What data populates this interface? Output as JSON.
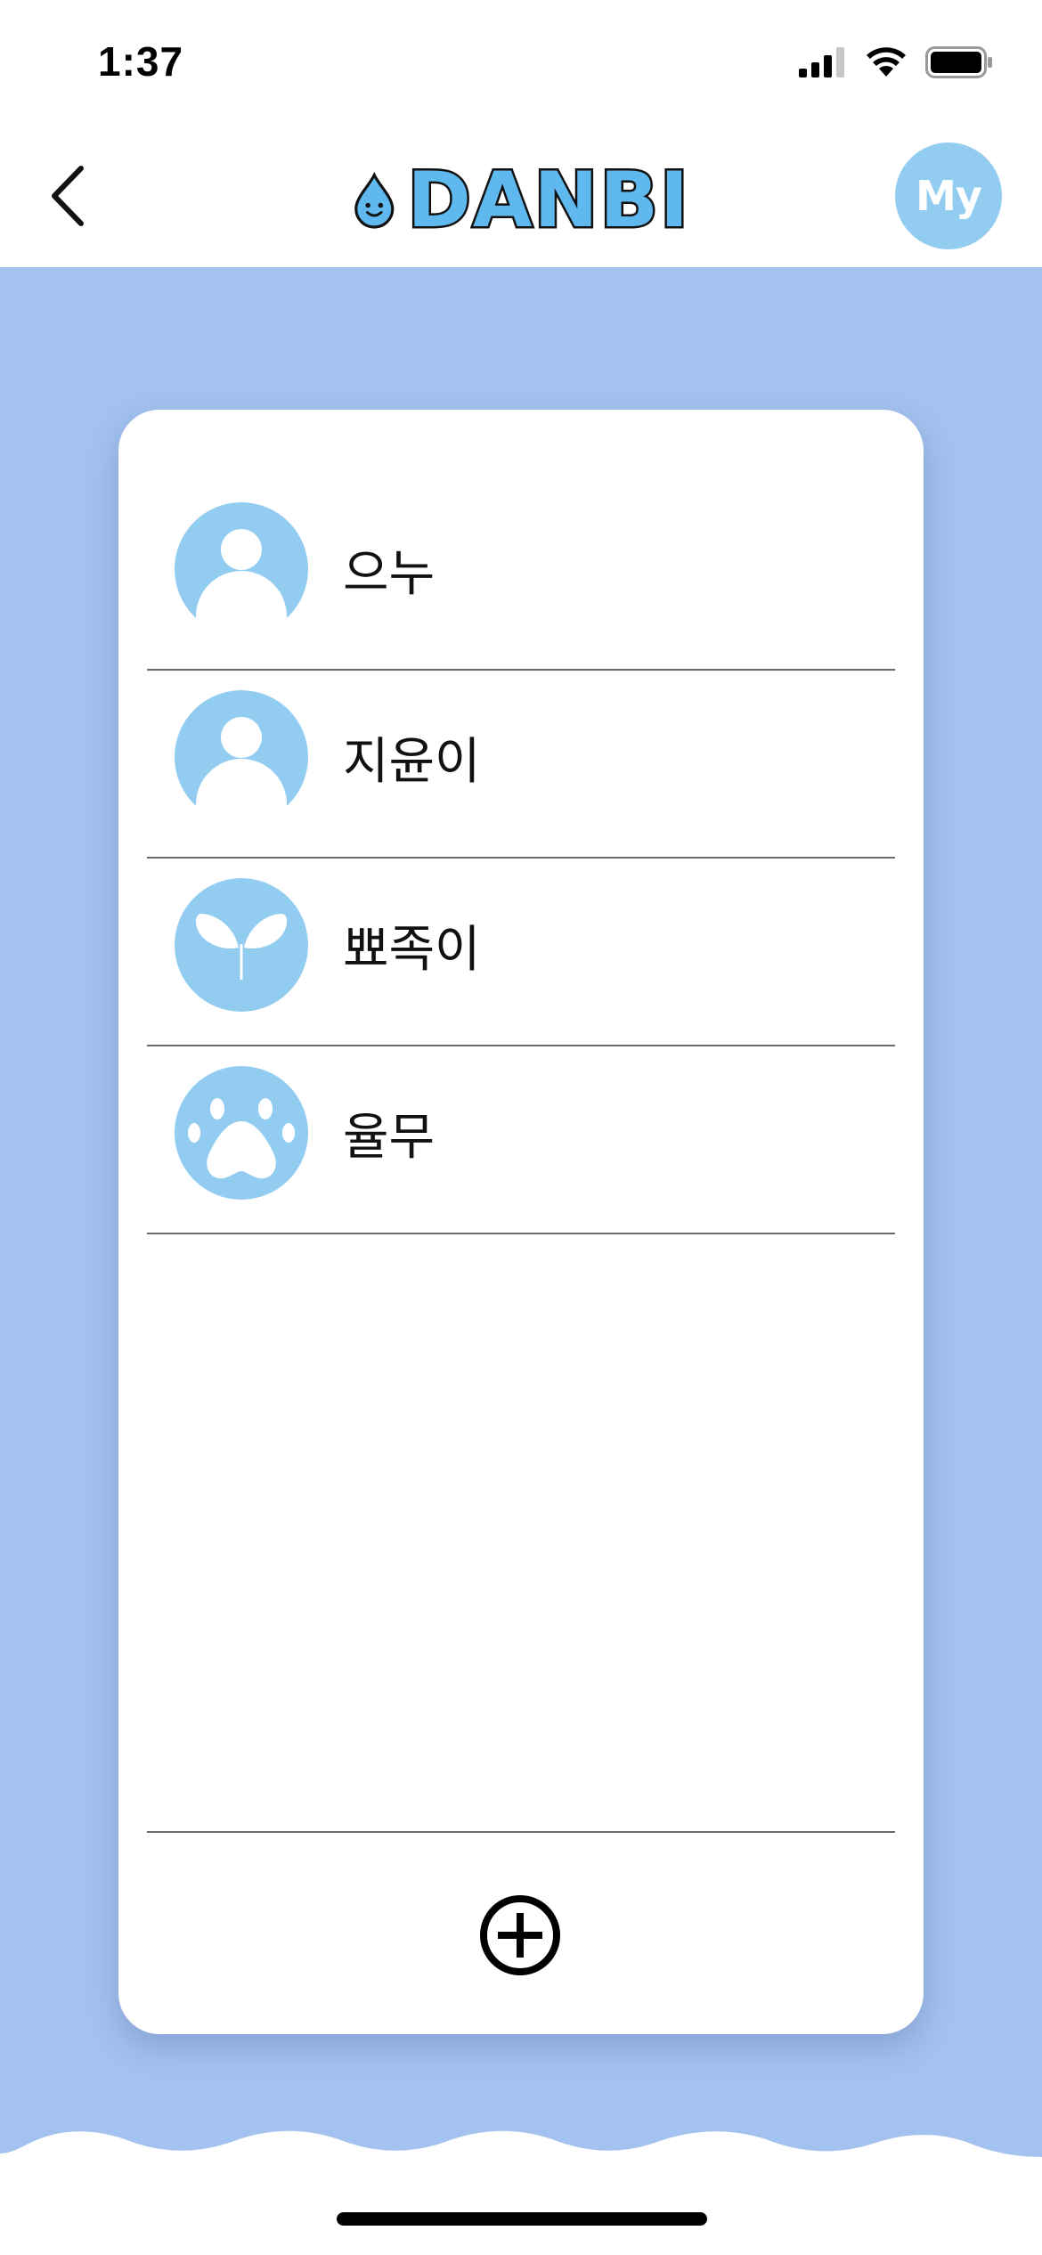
{
  "status_bar": {
    "time": "1:37",
    "icons": [
      "cellular-signal-icon",
      "wifi-icon",
      "battery-icon"
    ]
  },
  "header": {
    "back_icon": "chevron-left-icon",
    "brand": {
      "logo_icon": "water-drop-icon",
      "name": "DANBI"
    },
    "profile_button_label": "My"
  },
  "list": {
    "items": [
      {
        "name": "으누",
        "icon": "person-icon"
      },
      {
        "name": "지윤이",
        "icon": "person-icon"
      },
      {
        "name": "뾰족이",
        "icon": "sprout-icon"
      },
      {
        "name": "율무",
        "icon": "paw-icon"
      }
    ]
  },
  "add_button_icon": "plus-circle-icon",
  "colors": {
    "background": "#a3c2ef",
    "avatar": "#92cdf1",
    "brand": "#5fb8ee",
    "card": "#ffffff"
  }
}
